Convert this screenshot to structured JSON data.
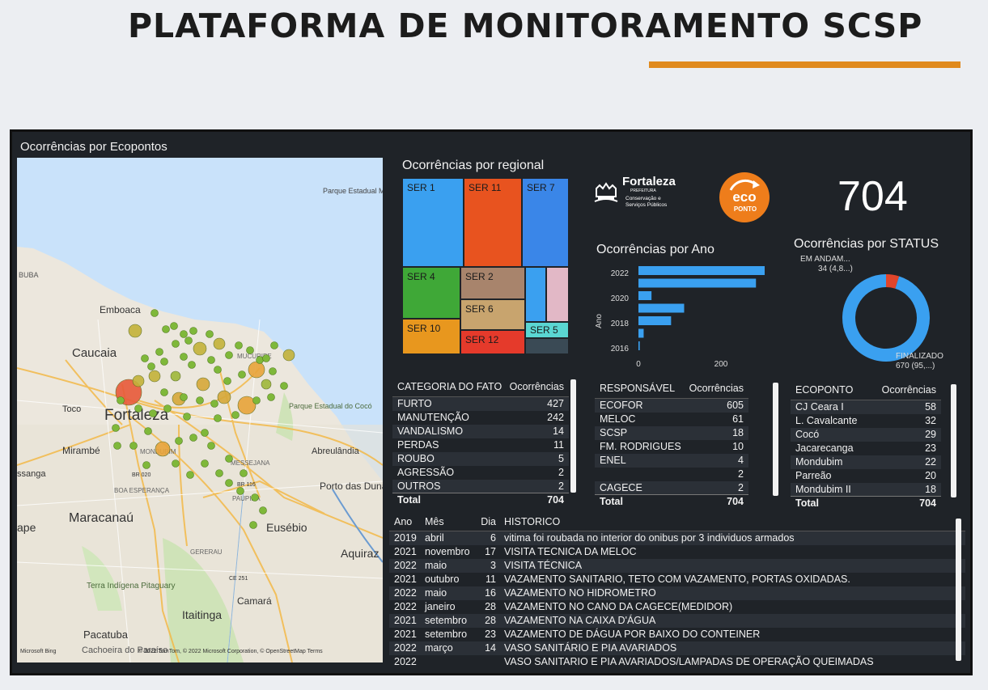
{
  "page_title": "PLATAFORMA DE MONITORAMENTO SCSP",
  "colors": {
    "accent_orange": "#e08a1e",
    "dashboard_bg": "#1f2328",
    "bar_blue": "#3aa0f0",
    "donut_blue": "#3aa0f0",
    "donut_red": "#e0452b"
  },
  "map": {
    "title": "Ocorrências por Ecopontos",
    "places": [
      "Parque Estadual Marinho da Pedra da Risca do Meio",
      "BUBA",
      "Emboaca",
      "Caucaia",
      "Toco",
      "Fortaleza",
      "Mirambé",
      "ssanga",
      "Maracanaú",
      "ape",
      "Eusébio",
      "Aquiraz",
      "Terra Indígena Pitaguary",
      "Camará",
      "Itaitinga",
      "Pacatuba",
      "Cachoeira do Paraíso",
      "Abreulândia",
      "Porto das Dunas",
      "Parque Estadual do Cocó",
      "MUCURIPE",
      "BOA ESPERANÇA",
      "MESSEJANA",
      "PAUPINA",
      "GERERAU",
      "MONDUBIM",
      "BR 020",
      "BR 116",
      "CE 251"
    ],
    "attribution": "© 2022 TomTom, © 2022 Microsoft Corporation, © OpenStreetMap  Terms",
    "bing": "Microsoft Bing"
  },
  "treemap": {
    "title": "Ocorrências por regional",
    "tiles": [
      {
        "label": "SER 1",
        "color": "#3aa0f0"
      },
      {
        "label": "SER 11",
        "color": "#e8531f"
      },
      {
        "label": "SER 7",
        "color": "#3a86e8"
      },
      {
        "label": "SER 4",
        "color": "#3fa837"
      },
      {
        "label": "SER 2",
        "color": "#a8846c"
      },
      {
        "label": "SER 6",
        "color": "#c8a46e"
      },
      {
        "label": "SER 10",
        "color": "#e8971e"
      },
      {
        "label": "SER 12",
        "color": "#e53a2b"
      },
      {
        "label": "SER 5",
        "color": "#5ad6d2"
      },
      {
        "label": "",
        "color": "#3aa0f0"
      },
      {
        "label": "",
        "color": "#e2b8c6"
      },
      {
        "label": "",
        "color": "#3a4a55"
      }
    ]
  },
  "logos": {
    "fortaleza_name": "Fortaleza",
    "fortaleza_sub": "PREFEITURA",
    "fortaleza_desc1": "Conservação e",
    "fortaleza_desc2": "Serviços Públicos",
    "eco_text1": "eco",
    "eco_text2": "PONTO"
  },
  "kpi": {
    "total": "704"
  },
  "ano_chart": {
    "title": "Ocorrências por Ano",
    "ylabel": "Ano",
    "y_ticks": [
      "2022",
      "2020",
      "2018",
      "2016"
    ],
    "x_ticks": [
      "0",
      "200"
    ]
  },
  "status_chart": {
    "title": "Ocorrências por STATUS",
    "label_em_andamento": "EM ANDAM...",
    "value_em_andamento": "34 (4,8...)",
    "label_finalizado": "FINALIZADO",
    "value_finalizado": "670 (95,...)"
  },
  "chart_data": [
    {
      "type": "bar",
      "title": "Ocorrências por Ano",
      "orientation": "horizontal",
      "ylabel": "Ano",
      "categories": [
        "2022",
        "2021",
        "2020",
        "2019",
        "2018",
        "2017",
        "2016"
      ],
      "values": [
        290,
        270,
        30,
        105,
        75,
        12,
        3
      ],
      "xlim": [
        0,
        290
      ]
    },
    {
      "type": "pie",
      "title": "Ocorrências por STATUS",
      "labels": [
        "EM ANDAM...",
        "FINALIZADO"
      ],
      "values": [
        34,
        670
      ]
    }
  ],
  "categoria": {
    "col1": "CATEGORIA DO FATO",
    "col2": "Ocorrências",
    "rows": [
      {
        "name": "FURTO",
        "value": "427"
      },
      {
        "name": "MANUTENÇÃO",
        "value": "242"
      },
      {
        "name": "VANDALISMO",
        "value": "14"
      },
      {
        "name": "PERDAS",
        "value": "11"
      },
      {
        "name": "ROUBO",
        "value": "5"
      },
      {
        "name": "AGRESSÃO",
        "value": "2"
      },
      {
        "name": "OUTROS",
        "value": "2"
      }
    ],
    "total_label": "Total",
    "total_value": "704"
  },
  "responsavel": {
    "col1": "RESPONSÁVEL",
    "col2": "Ocorrências",
    "rows": [
      {
        "name": "ECOFOR",
        "value": "605"
      },
      {
        "name": "MELOC",
        "value": "61"
      },
      {
        "name": "SCSP",
        "value": "18"
      },
      {
        "name": "FM. RODRIGUES",
        "value": "10"
      },
      {
        "name": "ENEL",
        "value": "4"
      },
      {
        "name": "",
        "value": "2"
      },
      {
        "name": "CAGECE",
        "value": "2"
      }
    ],
    "total_label": "Total",
    "total_value": "704"
  },
  "ecoponto": {
    "col1": "ECOPONTO",
    "col2": "Ocorrências",
    "rows": [
      {
        "name": "CJ Ceara I",
        "value": "58"
      },
      {
        "name": "L. Cavalcante",
        "value": "32"
      },
      {
        "name": "Cocó",
        "value": "29"
      },
      {
        "name": "Jacarecanga",
        "value": "23"
      },
      {
        "name": "Mondubim",
        "value": "22"
      },
      {
        "name": "Parreão",
        "value": "20"
      },
      {
        "name": "Mondubim II",
        "value": "18"
      }
    ],
    "total_label": "Total",
    "total_value": "704"
  },
  "historico": {
    "col_ano": "Ano",
    "col_mes": "Mês",
    "col_dia": "Dia",
    "col_hist": "HISTORICO",
    "rows": [
      {
        "ano": "2019",
        "mes": "abril",
        "dia": "6",
        "hist": "vitima foi roubada no interior do onibus por 3 individuos armados"
      },
      {
        "ano": "2021",
        "mes": "novembro",
        "dia": "17",
        "hist": "VISITA TECNICA DA MELOC"
      },
      {
        "ano": "2022",
        "mes": "maio",
        "dia": "3",
        "hist": "VISITA TÉCNICA"
      },
      {
        "ano": "2021",
        "mes": "outubro",
        "dia": "11",
        "hist": "VAZAMENTO SANITARIO, TETO COM VAZAMENTO, PORTAS OXIDADAS."
      },
      {
        "ano": "2022",
        "mes": "maio",
        "dia": "16",
        "hist": "VAZAMENTO NO HIDROMETRO"
      },
      {
        "ano": "2022",
        "mes": "janeiro",
        "dia": "28",
        "hist": "VAZAMENTO NO CANO DA CAGECE(MEDIDOR)"
      },
      {
        "ano": "2021",
        "mes": "setembro",
        "dia": "28",
        "hist": "VAZAMENTO NA CAIXA D'ÁGUA"
      },
      {
        "ano": "2021",
        "mes": "setembro",
        "dia": "23",
        "hist": "VAZAMENTO DE DÁGUA POR BAIXO DO CONTEINER"
      },
      {
        "ano": "2022",
        "mes": "março",
        "dia": "14",
        "hist": "VASO SANITÁRIO E PIA AVARIADOS"
      },
      {
        "ano": "2022",
        "mes": "",
        "dia": "",
        "hist": "VASO SANITARIO E PIA AVARIADOS/LAMPADAS DE OPERAÇÃO QUEIMADAS"
      }
    ]
  }
}
